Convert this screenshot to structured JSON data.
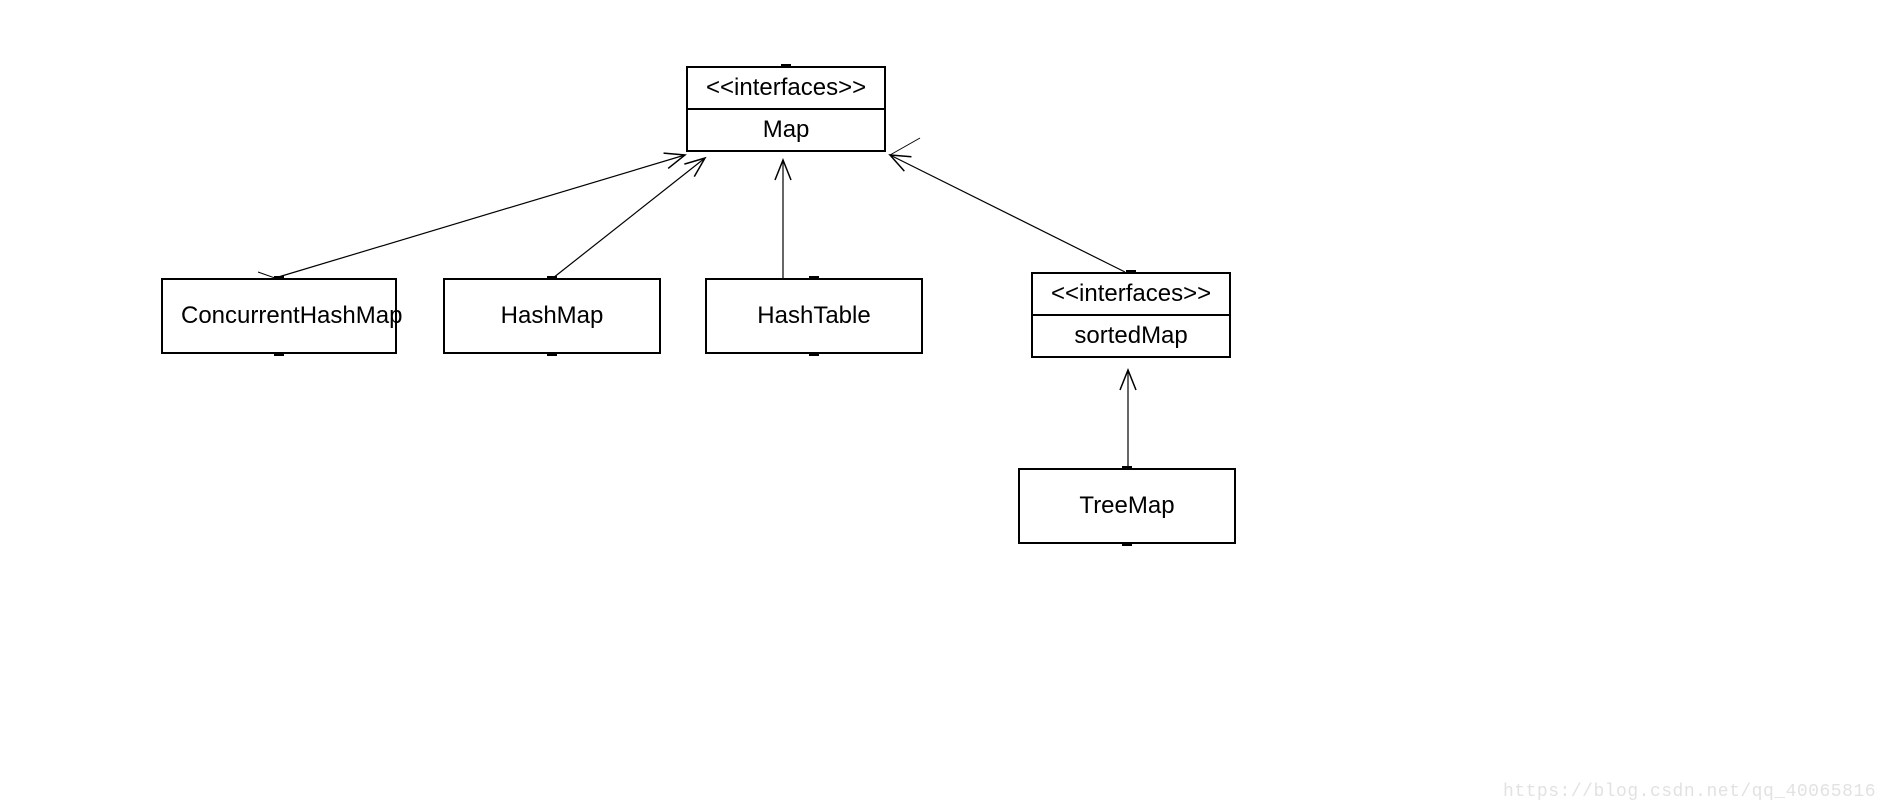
{
  "interfaceStereotype": "<<interfaces>>",
  "nodes": {
    "map": {
      "name": "Map"
    },
    "concurrentHashMap": {
      "name": "ConcurrentHashMap"
    },
    "hashMap": {
      "name": "HashMap"
    },
    "hashTable": {
      "name": "HashTable"
    },
    "sortedMap": {
      "name": "sortedMap"
    },
    "treeMap": {
      "name": "TreeMap"
    }
  },
  "watermark": "https://blog.csdn.net/qq_40065816"
}
